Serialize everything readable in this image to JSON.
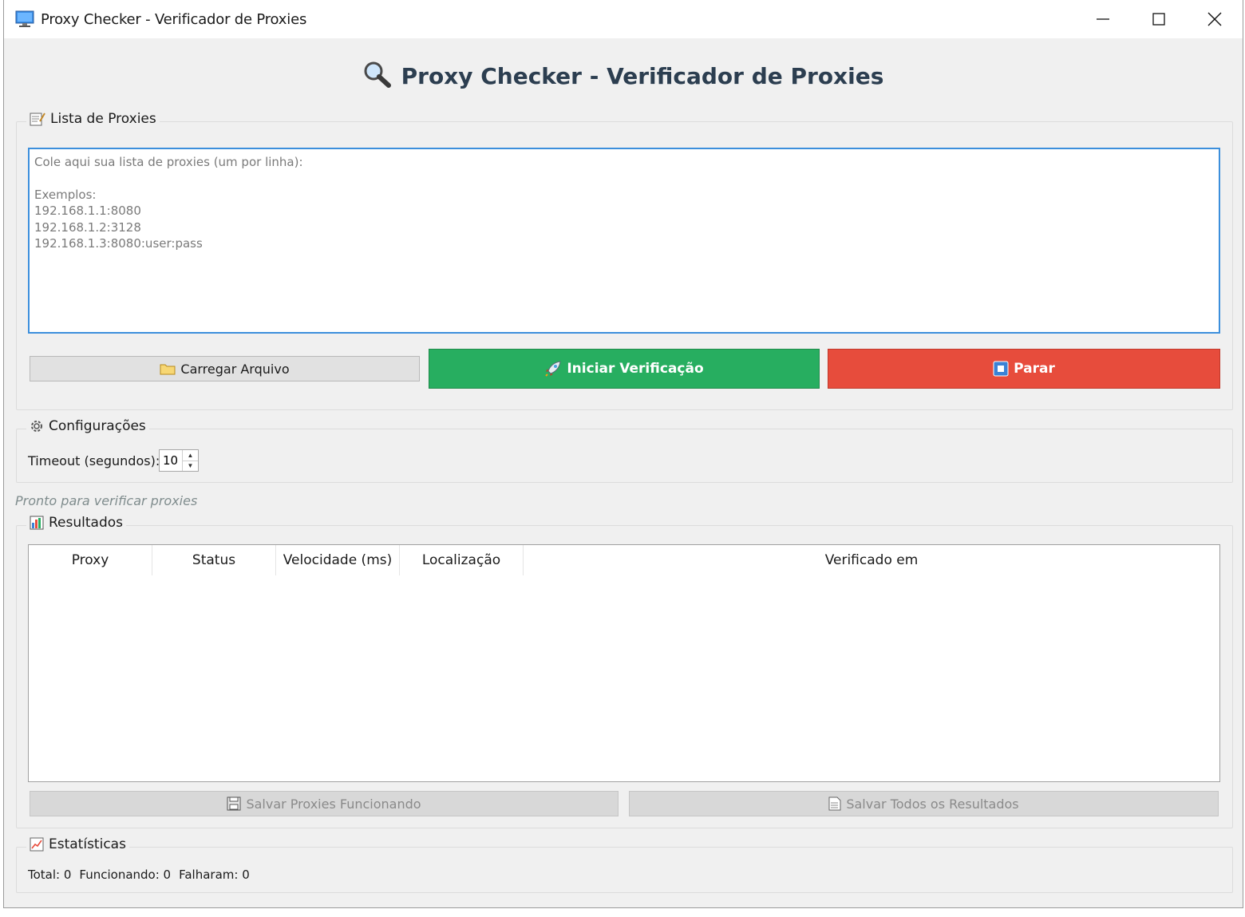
{
  "window": {
    "title": "Proxy Checker - Verificador de Proxies"
  },
  "heading": "Proxy Checker - Verificador de Proxies",
  "proxy_list": {
    "group_label": "Lista de Proxies",
    "placeholder": "Cole aqui sua lista de proxies (um por linha):\n\nExemplos:\n192.168.1.1:8080\n192.168.1.2:3128\n192.168.1.3:8080:user:pass",
    "value": ""
  },
  "actions": {
    "load_label": "Carregar Arquivo",
    "start_label": "Iniciar Verificação",
    "stop_label": "Parar",
    "start_color": "#27ae60",
    "stop_color": "#e74c3c"
  },
  "config": {
    "group_label": "Configurações",
    "timeout_label": "Timeout (segundos):",
    "timeout_value": "10"
  },
  "status": "Pronto para verificar proxies",
  "results": {
    "group_label": "Resultados",
    "columns": [
      "Proxy",
      "Status",
      "Velocidade (ms)",
      "Localização",
      "Verificado em"
    ],
    "rows": []
  },
  "save": {
    "working_label": "Salvar Proxies Funcionando",
    "all_label": "Salvar Todos os Resultados"
  },
  "stats": {
    "group_label": "Estatísticas",
    "total": "Total: 0",
    "working": "Funcionando: 0",
    "failed": "Falharam: 0"
  }
}
